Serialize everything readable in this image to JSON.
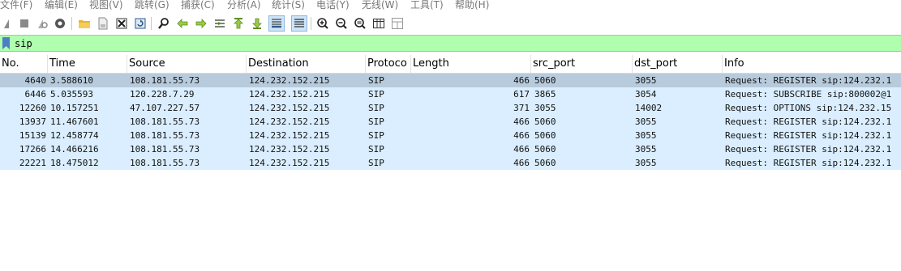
{
  "menu": [
    "文件(F)",
    "编辑(E)",
    "视图(V)",
    "跳转(G)",
    "捕获(C)",
    "分析(A)",
    "统计(S)",
    "电话(Y)",
    "无线(W)",
    "工具(T)",
    "帮助(H)"
  ],
  "toolbar": {
    "icons": [
      "shark-fin-start-icon",
      "stop-icon",
      "restart-icon",
      "capture-options-icon",
      "open-file-icon",
      "save-file-icon",
      "close-file-icon",
      "reload-icon",
      "find-packet-icon",
      "go-back-icon",
      "go-forward-icon",
      "go-to-packet-icon",
      "go-first-icon",
      "go-last-icon",
      "autoscroll-icon",
      "colorize-icon",
      "zoom-in-icon",
      "zoom-out-icon",
      "zoom-normal-icon",
      "resize-columns-icon",
      "layout-icon"
    ]
  },
  "filter": {
    "value": "sip",
    "bg_color": "#afffaf"
  },
  "columns": [
    "No.",
    "Time",
    "Source",
    "Destination",
    "Protoco",
    "Length",
    "src_port",
    "dst_port",
    "Info"
  ],
  "packets": [
    {
      "no": "4640",
      "time": "3.588610",
      "source": "108.181.55.73",
      "destination": "124.232.152.215",
      "protocol": "SIP",
      "length": "466",
      "src_port": "5060",
      "dst_port": "3055",
      "info": "Request: REGISTER sip:124.232.1",
      "selected": true
    },
    {
      "no": "6446",
      "time": "5.035593",
      "source": "120.228.7.29",
      "destination": "124.232.152.215",
      "protocol": "SIP",
      "length": "617",
      "src_port": "3865",
      "dst_port": "3054",
      "info": "Request: SUBSCRIBE sip:800002@1"
    },
    {
      "no": "12260",
      "time": "10.157251",
      "source": "47.107.227.57",
      "destination": "124.232.152.215",
      "protocol": "SIP",
      "length": "371",
      "src_port": "3055",
      "dst_port": "14002",
      "info": "Request: OPTIONS sip:124.232.15"
    },
    {
      "no": "13937",
      "time": "11.467601",
      "source": "108.181.55.73",
      "destination": "124.232.152.215",
      "protocol": "SIP",
      "length": "466",
      "src_port": "5060",
      "dst_port": "3055",
      "info": "Request: REGISTER sip:124.232.1"
    },
    {
      "no": "15139",
      "time": "12.458774",
      "source": "108.181.55.73",
      "destination": "124.232.152.215",
      "protocol": "SIP",
      "length": "466",
      "src_port": "5060",
      "dst_port": "3055",
      "info": "Request: REGISTER sip:124.232.1"
    },
    {
      "no": "17266",
      "time": "14.466216",
      "source": "108.181.55.73",
      "destination": "124.232.152.215",
      "protocol": "SIP",
      "length": "466",
      "src_port": "5060",
      "dst_port": "3055",
      "info": "Request: REGISTER sip:124.232.1"
    },
    {
      "no": "22221",
      "time": "18.475012",
      "source": "108.181.55.73",
      "destination": "124.232.152.215",
      "protocol": "SIP",
      "length": "466",
      "src_port": "5060",
      "dst_port": "3055",
      "info": "Request: REGISTER sip:124.232.1"
    }
  ],
  "colors": {
    "row_bg": "#daeeff",
    "selected_row_bg": "#b8cbdc"
  }
}
